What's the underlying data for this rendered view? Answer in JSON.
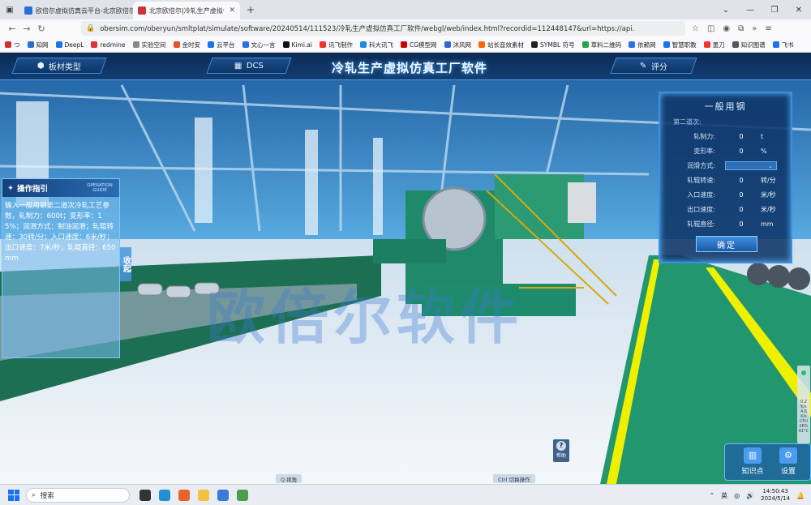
{
  "browser": {
    "tabs": [
      {
        "title": "欧倍尔虚拟仿真云平台-北京欧倍尔",
        "active": false
      },
      {
        "title": "北京欧倍尔|冷轧生产虚拟仿真...",
        "active": true
      }
    ],
    "new_tab": "+",
    "url": "obersim.com/oberyun/smltplat/simulate/software/20240514/111523/冷轧生产虚拟仿真工厂软件/webgl/web/index.html?recordid=112448147&url=https://api.",
    "bookmarks": [
      "つ",
      "知网",
      "DeepL",
      "redmine",
      "实验空间",
      "金时安",
      "云平台",
      "文心一言",
      "Kimi.ai",
      "讯飞制作",
      "科大讯飞",
      "CG模型网",
      "沐风网",
      "站长音效素材",
      "SYMBL 符号",
      "草料二维码",
      "依赖网",
      "智慧职教",
      "墨刀",
      "知识图谱",
      "飞书"
    ]
  },
  "hud": {
    "title": "冷轧生产虚拟仿真工厂软件",
    "left_btn": "板材类型",
    "dcs_btn": "DCS",
    "score_btn": "评分"
  },
  "guide": {
    "title": "操作指引",
    "subtitle": "OPERATION GUIDE",
    "text": "输入一般用钢第二道次冷轧工艺参数，轧制力：600t；变形率：15%；润滑方式：制油润滑；轧辊转速：30转/分；入口速度：6米/秒；出口速度：7米/秒；轧辊直径：650mm",
    "collapse": "收起"
  },
  "panel": {
    "title": "一般用钢",
    "subtitle": "第二道次:",
    "rows": [
      {
        "label": "轧制力:",
        "value": "0",
        "unit": "t"
      },
      {
        "label": "变形率:",
        "value": "0",
        "unit": "%"
      },
      {
        "label": "润滑方式:",
        "value": "",
        "unit": ""
      },
      {
        "label": "轧辊转速:",
        "value": "0",
        "unit": "转/分"
      },
      {
        "label": "入口速度:",
        "value": "0",
        "unit": "米/秒"
      },
      {
        "label": "出口速度:",
        "value": "0",
        "unit": "米/秒"
      },
      {
        "label": "轧辊直径:",
        "value": "0",
        "unit": "mm"
      }
    ],
    "confirm": "确定"
  },
  "overlay": {
    "watermark": "欧倍尔软件",
    "help": "帮助",
    "hint_view": "Q 视角",
    "hint_switch": "Ctrl 切换操作",
    "knowledge": "知识点",
    "settings": "设置",
    "meter": {
      "v1": "0.2",
      "u1": "K/s",
      "v2": "4.8",
      "u2": "K/s",
      "cpu_label": "CPU",
      "cpu": "26%",
      "temp": "61°C"
    }
  },
  "taskbar": {
    "search_placeholder": "搜索",
    "ime": "英",
    "time": "14:50:43",
    "date": "2024/5/14"
  }
}
